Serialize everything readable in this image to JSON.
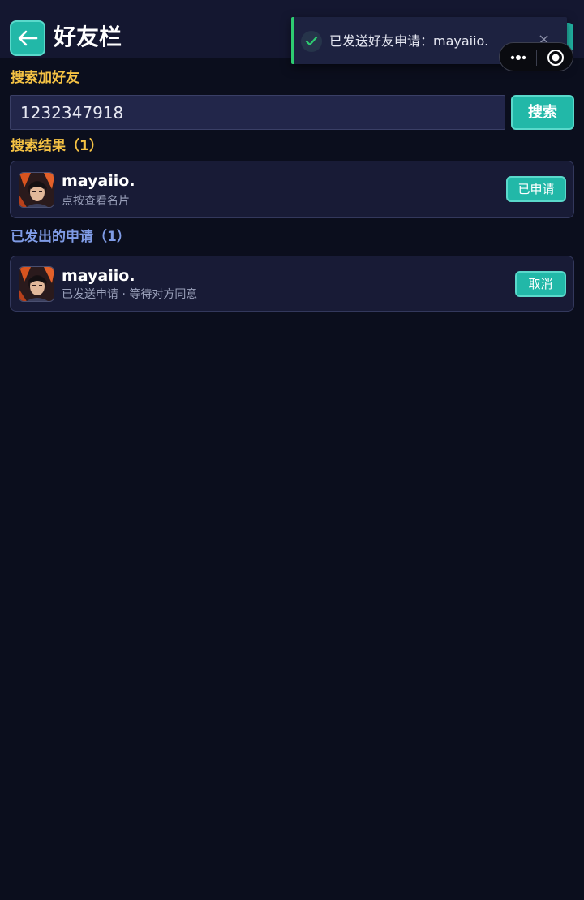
{
  "header": {
    "title": "好友栏",
    "back_icon": "arrow-left-icon"
  },
  "toast": {
    "message": "已发送好友申请：mayaiio.",
    "close": "×",
    "status_color": "#2ecc71"
  },
  "capsule": {
    "more_icon": "more-dots-icon",
    "close_icon": "target-circle-icon"
  },
  "search": {
    "section_title": "搜索加好友",
    "value": "1232347918",
    "button_label": "搜索"
  },
  "results": {
    "section_title": "搜索结果（1）",
    "items": [
      {
        "name": "mayaiio.",
        "subtitle": "点按查看名片",
        "button_label": "已申请"
      }
    ]
  },
  "sent_requests": {
    "section_title": "已发出的申请（1）",
    "items": [
      {
        "name": "mayaiio.",
        "subtitle": "已发送申请 · 等待对方同意",
        "button_label": "取消"
      }
    ]
  },
  "colors": {
    "accent": "#22b8a8",
    "background": "#0b0e1d",
    "section_yellow": "#f5c244",
    "section_blue": "#7f9be6"
  }
}
